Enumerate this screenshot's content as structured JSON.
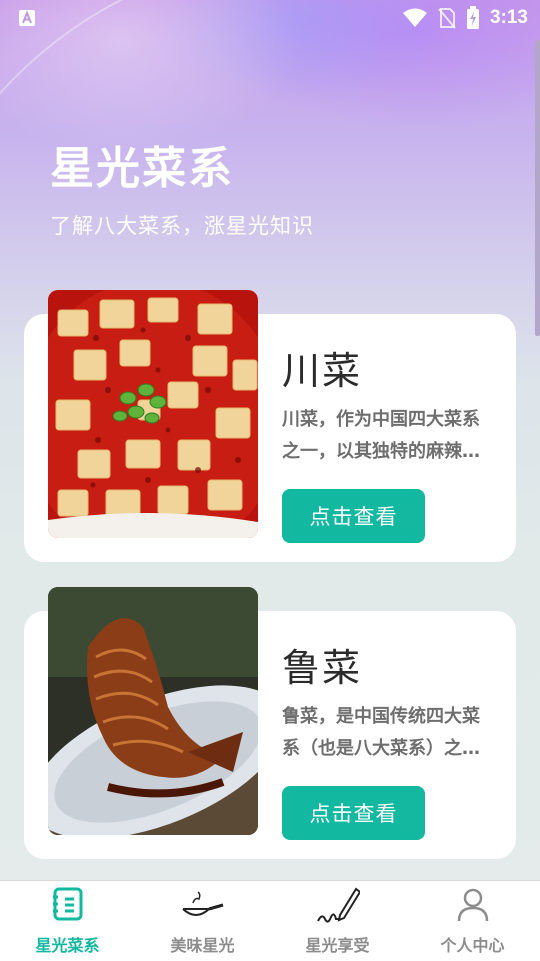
{
  "status_bar": {
    "time": "3:13",
    "icons": [
      "app-a-icon",
      "wifi-icon",
      "no-sim-icon",
      "battery-charging-icon"
    ]
  },
  "header": {
    "title": "星光菜系",
    "subtitle": "了解八大菜系，涨星光知识"
  },
  "cards": [
    {
      "title": "川菜",
      "description": "川菜，作为中国四大菜系之一，以其独特的麻辣口味闻名。",
      "button_label": "点击查看"
    },
    {
      "title": "鲁菜",
      "description": "鲁菜，是中国传统四大菜系（也是八大菜系）之首。",
      "button_label": "点击查看"
    }
  ],
  "tabs": [
    {
      "label": "星光菜系",
      "icon": "book-icon",
      "active": true
    },
    {
      "label": "美味星光",
      "icon": "frying-pan-icon",
      "active": false
    },
    {
      "label": "星光享受",
      "icon": "pen-signature-icon",
      "active": false
    },
    {
      "label": "个人中心",
      "icon": "person-icon",
      "active": false
    }
  ],
  "colors": {
    "accent": "#13b8a0",
    "tab_inactive": "#8c8c8c",
    "card_background": "#ffffff"
  }
}
